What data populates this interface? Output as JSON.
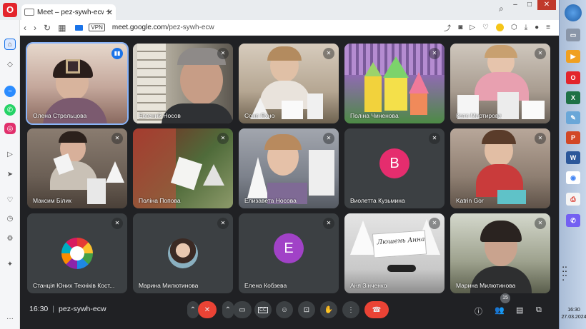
{
  "browser": {
    "tab_title": "Meet – pez-sywh-ecw",
    "new_tab": "+",
    "url_host": "meet.google.com",
    "url_path": "/pez-sywh-ecw",
    "vpn_label": "VPN",
    "min": "–",
    "max": "□",
    "close": "✕"
  },
  "participants": [
    {
      "name": "Олена Стрельцова",
      "mic": "on",
      "bg": "#c9b8a8"
    },
    {
      "name": "Евгений Носов",
      "mic": "off",
      "bg": "#8a8478"
    },
    {
      "name": "Соня Яхно",
      "mic": "off",
      "bg": "#b7a890"
    },
    {
      "name": "Поліна Чиненова",
      "mic": "off",
      "bg": "#9b7bb5"
    },
    {
      "name": "Катя Мартирова",
      "mic": "off",
      "bg": "#9e958d"
    },
    {
      "name": "Максим Білик",
      "mic": "off",
      "bg": "#8e8377"
    },
    {
      "name": "Поліна Попова",
      "mic": "off",
      "bg": "#6d7a55"
    },
    {
      "name": "Елизавета Носова",
      "mic": "off",
      "bg": "#8b8f99"
    },
    {
      "name": "Виолетта Кузьмина",
      "mic": "off",
      "avatar": "В",
      "avatar_color": "#e52d6e"
    },
    {
      "name": "Katrin Gor",
      "mic": "off",
      "bg": "#a98f82"
    },
    {
      "name": "Станція Юних Техніків Кост...",
      "mic": "off",
      "logo": true
    },
    {
      "name": "Марина Милютинова",
      "mic": "off",
      "photo_avatar": true
    },
    {
      "name": "Елена Кобзева",
      "mic": "off",
      "avatar": "Е",
      "avatar_color": "#a142c7"
    },
    {
      "name": "Аня Зінченко",
      "mic": "off",
      "bg": "#cfcfcf",
      "sign_text": "Люшень Анна"
    },
    {
      "name": "Марина Милютинова",
      "mic": "off",
      "bg": "#8c8f7a"
    }
  ],
  "controls": {
    "time": "16:30",
    "meeting_code": "pez-sywh-ecw",
    "people_count": "15"
  },
  "taskbar": {
    "clock_time": "16:30",
    "clock_date": "27.03.2024"
  }
}
